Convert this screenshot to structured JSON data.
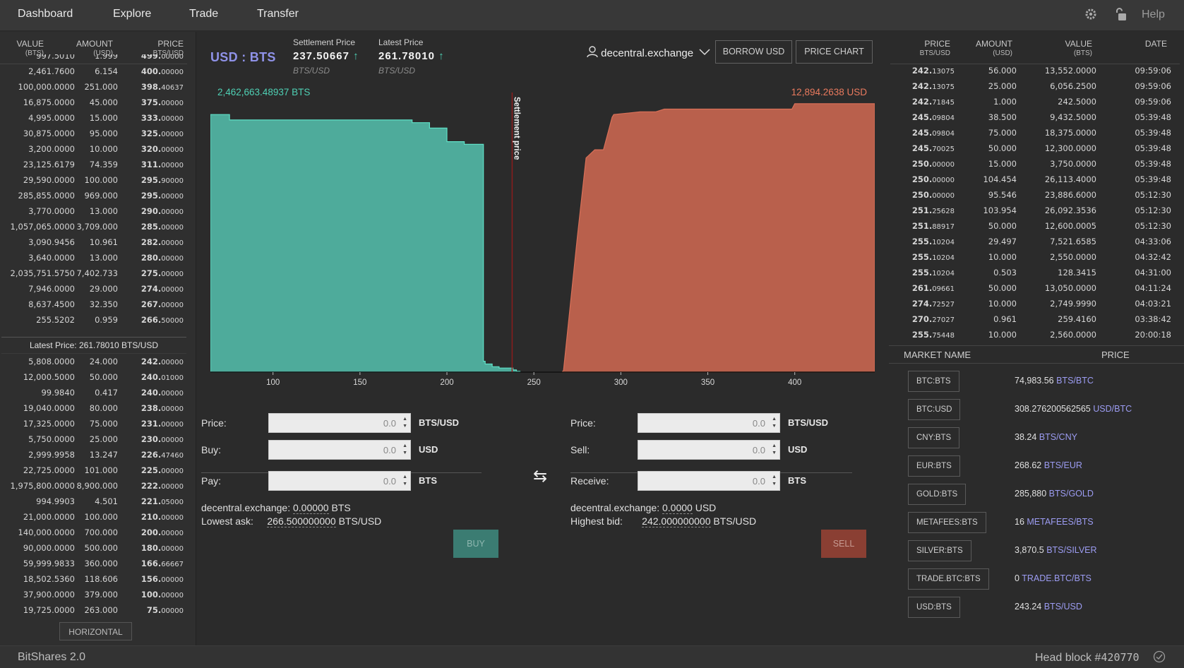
{
  "nav": {
    "items": [
      "Dashboard",
      "Explore",
      "Trade",
      "Transfer"
    ],
    "help": "Help",
    "icons": [
      "gear-icon",
      "lock-icon"
    ]
  },
  "orderbook": {
    "headers": [
      {
        "label": "VALUE",
        "unit": "(BTS)"
      },
      {
        "label": "AMOUNT",
        "unit": "(USD)"
      },
      {
        "label": "PRICE",
        "unit": "BTS/USD"
      }
    ],
    "asks": [
      {
        "value": "997.5010",
        "amount": "1.999",
        "price_int": "499.",
        "price_dec": "00000"
      },
      {
        "value": "2,461.7600",
        "amount": "6.154",
        "price_int": "400.",
        "price_dec": "00000"
      },
      {
        "value": "100,000.0000",
        "amount": "251.000",
        "price_int": "398.",
        "price_dec": "40637"
      },
      {
        "value": "16,875.0000",
        "amount": "45.000",
        "price_int": "375.",
        "price_dec": "00000"
      },
      {
        "value": "4,995.0000",
        "amount": "15.000",
        "price_int": "333.",
        "price_dec": "00000"
      },
      {
        "value": "30,875.0000",
        "amount": "95.000",
        "price_int": "325.",
        "price_dec": "00000"
      },
      {
        "value": "3,200.0000",
        "amount": "10.000",
        "price_int": "320.",
        "price_dec": "00000"
      },
      {
        "value": "23,125.6179",
        "amount": "74.359",
        "price_int": "311.",
        "price_dec": "00000"
      },
      {
        "value": "29,590.0000",
        "amount": "100.000",
        "price_int": "295.",
        "price_dec": "90000"
      },
      {
        "value": "285,855.0000",
        "amount": "969.000",
        "price_int": "295.",
        "price_dec": "00000"
      },
      {
        "value": "3,770.0000",
        "amount": "13.000",
        "price_int": "290.",
        "price_dec": "00000"
      },
      {
        "value": "1,057,065.0000",
        "amount": "3,709.000",
        "price_int": "285.",
        "price_dec": "00000"
      },
      {
        "value": "3,090.9456",
        "amount": "10.961",
        "price_int": "282.",
        "price_dec": "00000"
      },
      {
        "value": "3,640.0000",
        "amount": "13.000",
        "price_int": "280.",
        "price_dec": "00000"
      },
      {
        "value": "2,035,751.5750",
        "amount": "7,402.733",
        "price_int": "275.",
        "price_dec": "00000"
      },
      {
        "value": "7,946.0000",
        "amount": "29.000",
        "price_int": "274.",
        "price_dec": "00000"
      },
      {
        "value": "8,637.4500",
        "amount": "32.350",
        "price_int": "267.",
        "price_dec": "00000"
      },
      {
        "value": "255.5202",
        "amount": "0.959",
        "price_int": "266.",
        "price_dec": "50000"
      }
    ],
    "latest_price": "Latest Price: 261.78010 BTS/USD",
    "bids": [
      {
        "value": "5,808.0000",
        "amount": "24.000",
        "price_int": "242.",
        "price_dec": "00000"
      },
      {
        "value": "12,000.5000",
        "amount": "50.000",
        "price_int": "240.",
        "price_dec": "01000"
      },
      {
        "value": "99.9840",
        "amount": "0.417",
        "price_int": "240.",
        "price_dec": "00000"
      },
      {
        "value": "19,040.0000",
        "amount": "80.000",
        "price_int": "238.",
        "price_dec": "00000"
      },
      {
        "value": "17,325.0000",
        "amount": "75.000",
        "price_int": "231.",
        "price_dec": "00000"
      },
      {
        "value": "5,750.0000",
        "amount": "25.000",
        "price_int": "230.",
        "price_dec": "00000"
      },
      {
        "value": "2,999.9958",
        "amount": "13.247",
        "price_int": "226.",
        "price_dec": "47460"
      },
      {
        "value": "22,725.0000",
        "amount": "101.000",
        "price_int": "225.",
        "price_dec": "00000"
      },
      {
        "value": "1,975,800.0000",
        "amount": "8,900.000",
        "price_int": "222.",
        "price_dec": "00000"
      },
      {
        "value": "994.9903",
        "amount": "4.501",
        "price_int": "221.",
        "price_dec": "05000"
      },
      {
        "value": "21,000.0000",
        "amount": "100.000",
        "price_int": "210.",
        "price_dec": "00000"
      },
      {
        "value": "140,000.0000",
        "amount": "700.000",
        "price_int": "200.",
        "price_dec": "00000"
      },
      {
        "value": "90,000.0000",
        "amount": "500.000",
        "price_int": "180.",
        "price_dec": "00000"
      },
      {
        "value": "59,999.9833",
        "amount": "360.000",
        "price_int": "166.",
        "price_dec": "66667"
      },
      {
        "value": "18,502.5360",
        "amount": "118.606",
        "price_int": "156.",
        "price_dec": "00000"
      },
      {
        "value": "37,900.0000",
        "amount": "379.000",
        "price_int": "100.",
        "price_dec": "00000"
      },
      {
        "value": "19,725.0000",
        "amount": "263.000",
        "price_int": "75.",
        "price_dec": "00000"
      }
    ],
    "horizontal_button": "HORIZONTAL"
  },
  "market": {
    "pair": "USD : BTS",
    "settlement": {
      "label": "Settlement Price",
      "value": "237.50667",
      "arrow": "↑",
      "unit": "BTS/USD"
    },
    "latest": {
      "label": "Latest Price",
      "value": "261.78010",
      "arrow": "↑",
      "unit": "BTS/USD"
    },
    "account": "decentral.exchange",
    "borrow_button": "BORROW USD",
    "price_chart_button": "PRICE CHART"
  },
  "depth_chart": {
    "bid_total": "2,462,663.48937 BTS",
    "ask_total": "12,894.2638 USD",
    "settlement_label": "Settlement price",
    "x_ticks": [
      "100",
      "150",
      "200",
      "250",
      "300",
      "350",
      "400"
    ],
    "colors": {
      "bid": "#4eab9b",
      "ask": "#b9604c",
      "settlement": "#8a1d1d"
    }
  },
  "chart_data": {
    "type": "area",
    "title": "",
    "xlabel": "",
    "ylabel": "",
    "xlim": [
      64,
      446
    ],
    "x_ticks": [
      100,
      150,
      200,
      250,
      300,
      350,
      400
    ],
    "settlement_price": 237.50667,
    "series": [
      {
        "name": "bids",
        "side": "buy",
        "x": [
          64,
          75,
          75,
          100,
          100,
          180,
          180,
          190,
          190,
          200,
          200,
          210,
          210,
          221,
          221,
          222,
          222,
          226,
          226,
          230,
          230,
          238,
          238,
          240,
          240,
          242
        ],
        "y": [
          0.95,
          0.95,
          0.93,
          0.93,
          0.93,
          0.93,
          0.92,
          0.92,
          0.9,
          0.9,
          0.85,
          0.85,
          0.84,
          0.84,
          0.04,
          0.04,
          0.03,
          0.03,
          0.02,
          0.02,
          0.015,
          0.015,
          0.008,
          0.008,
          0.003,
          0.003
        ]
      },
      {
        "name": "asks",
        "side": "sell",
        "x": [
          266.5,
          267,
          275,
          275,
          280,
          285,
          290,
          295,
          295.9,
          311,
          320,
          325,
          333,
          375,
          398.4,
          400,
          446
        ],
        "y": [
          0.003,
          0.005,
          0.5,
          0.5,
          0.79,
          0.82,
          0.82,
          0.94,
          0.95,
          0.96,
          0.96,
          0.97,
          0.97,
          0.97,
          0.97,
          0.99,
          0.99
        ]
      }
    ]
  },
  "buy_form": {
    "price_label": "Price:",
    "price_value": "0.0",
    "price_unit": "BTS/USD",
    "buy_label": "Buy:",
    "buy_value": "0.0",
    "buy_unit": "USD",
    "pay_label": "Pay:",
    "pay_value": "0.0",
    "pay_unit": "BTS",
    "balance_label": "decentral.exchange:",
    "balance_value": "0.00000",
    "balance_unit": "BTS",
    "lowest_label": "Lowest ask:",
    "lowest_value": "266.500000000",
    "lowest_unit": "BTS/USD",
    "button": "BUY",
    "button_color": "#3b7c72"
  },
  "sell_form": {
    "price_label": "Price:",
    "price_value": "0.0",
    "price_unit": "BTS/USD",
    "sell_label": "Sell:",
    "sell_value": "0.0",
    "sell_unit": "USD",
    "receive_label": "Receive:",
    "receive_value": "0.0",
    "receive_unit": "BTS",
    "balance_label": "decentral.exchange:",
    "balance_value": "0.0000",
    "balance_unit": "USD",
    "highest_label": "Highest bid:",
    "highest_value": "242.000000000",
    "highest_unit": "BTS/USD",
    "button": "SELL",
    "button_color": "#8a3f33"
  },
  "trade_history": {
    "headers": [
      {
        "label": "PRICE",
        "unit": "BTS/USD"
      },
      {
        "label": "AMOUNT",
        "unit": "(USD)"
      },
      {
        "label": "VALUE",
        "unit": "(BTS)"
      },
      {
        "label": "DATE",
        "unit": ""
      }
    ],
    "rows": [
      {
        "p_int": "242.",
        "p_dec": "13075",
        "side": "bid",
        "amount": "56.000",
        "value": "13,552.0000",
        "date": "09:59:06"
      },
      {
        "p_int": "242.",
        "p_dec": "13075",
        "side": "bid",
        "amount": "25.000",
        "value": "6,056.2500",
        "date": "09:59:06"
      },
      {
        "p_int": "242.",
        "p_dec": "71845",
        "side": "bid",
        "amount": "1.000",
        "value": "242.5000",
        "date": "09:59:06"
      },
      {
        "p_int": "245.",
        "p_dec": "09804",
        "side": "bid",
        "amount": "38.500",
        "value": "9,432.5000",
        "date": "05:39:48"
      },
      {
        "p_int": "245.",
        "p_dec": "09804",
        "side": "bid",
        "amount": "75.000",
        "value": "18,375.0000",
        "date": "05:39:48"
      },
      {
        "p_int": "245.",
        "p_dec": "70025",
        "side": "bid",
        "amount": "50.000",
        "value": "12,300.0000",
        "date": "05:39:48"
      },
      {
        "p_int": "250.",
        "p_dec": "00000",
        "side": "bid",
        "amount": "15.000",
        "value": "3,750.0000",
        "date": "05:39:48"
      },
      {
        "p_int": "250.",
        "p_dec": "00000",
        "side": "bid",
        "amount": "104.454",
        "value": "26,113.4000",
        "date": "05:39:48"
      },
      {
        "p_int": "250.",
        "p_dec": "00000",
        "side": "bid",
        "amount": "95.546",
        "value": "23,886.6000",
        "date": "05:12:30"
      },
      {
        "p_int": "251.",
        "p_dec": "25628",
        "side": "bid",
        "amount": "103.954",
        "value": "26,092.3536",
        "date": "05:12:30"
      },
      {
        "p_int": "251.",
        "p_dec": "88917",
        "side": "bid",
        "amount": "50.000",
        "value": "12,600.0005",
        "date": "05:12:30"
      },
      {
        "p_int": "255.",
        "p_dec": "10204",
        "side": "ask",
        "amount": "29.497",
        "value": "7,521.6585",
        "date": "04:33:06"
      },
      {
        "p_int": "255.",
        "p_dec": "10204",
        "side": "ask",
        "amount": "10.000",
        "value": "2,550.0000",
        "date": "04:32:42"
      },
      {
        "p_int": "255.",
        "p_dec": "10204",
        "side": "bid",
        "amount": "0.503",
        "value": "128.3415",
        "date": "04:31:00"
      },
      {
        "p_int": "261.",
        "p_dec": "09661",
        "side": "bid",
        "amount": "50.000",
        "value": "13,050.0000",
        "date": "04:11:24"
      },
      {
        "p_int": "274.",
        "p_dec": "72527",
        "side": "ask",
        "amount": "10.000",
        "value": "2,749.9990",
        "date": "04:03:21"
      },
      {
        "p_int": "270.",
        "p_dec": "27027",
        "side": "ask",
        "amount": "0.961",
        "value": "259.4160",
        "date": "03:38:42"
      },
      {
        "p_int": "255.",
        "p_dec": "75448",
        "side": "bid",
        "amount": "10.000",
        "value": "2,560.0000",
        "date": "20:00:18"
      }
    ]
  },
  "markets": {
    "header_name": "MARKET NAME",
    "header_price": "PRICE",
    "rows": [
      {
        "name": "BTC:BTS",
        "price": "74,983.56",
        "unit": "BTS/BTC"
      },
      {
        "name": "BTC:USD",
        "price": "308.276200562565",
        "unit": "USD/BTC"
      },
      {
        "name": "CNY:BTS",
        "price": "38.24",
        "unit": "BTS/CNY"
      },
      {
        "name": "EUR:BTS",
        "price": "268.62",
        "unit": "BTS/EUR"
      },
      {
        "name": "GOLD:BTS",
        "price": "285,880",
        "unit": "BTS/GOLD"
      },
      {
        "name": "METAFEES:BTS",
        "price": "16",
        "unit": "METAFEES/BTS"
      },
      {
        "name": "SILVER:BTS",
        "price": "3,870.5",
        "unit": "BTS/SILVER"
      },
      {
        "name": "TRADE.BTC:BTS",
        "price": "0",
        "unit": "TRADE.BTC/BTS"
      },
      {
        "name": "USD:BTS",
        "price": "243.24",
        "unit": "BTS/USD"
      }
    ]
  },
  "footer": {
    "brand": "BitShares 2.0",
    "head_block_label": "Head block #",
    "head_block_num": "420770"
  }
}
